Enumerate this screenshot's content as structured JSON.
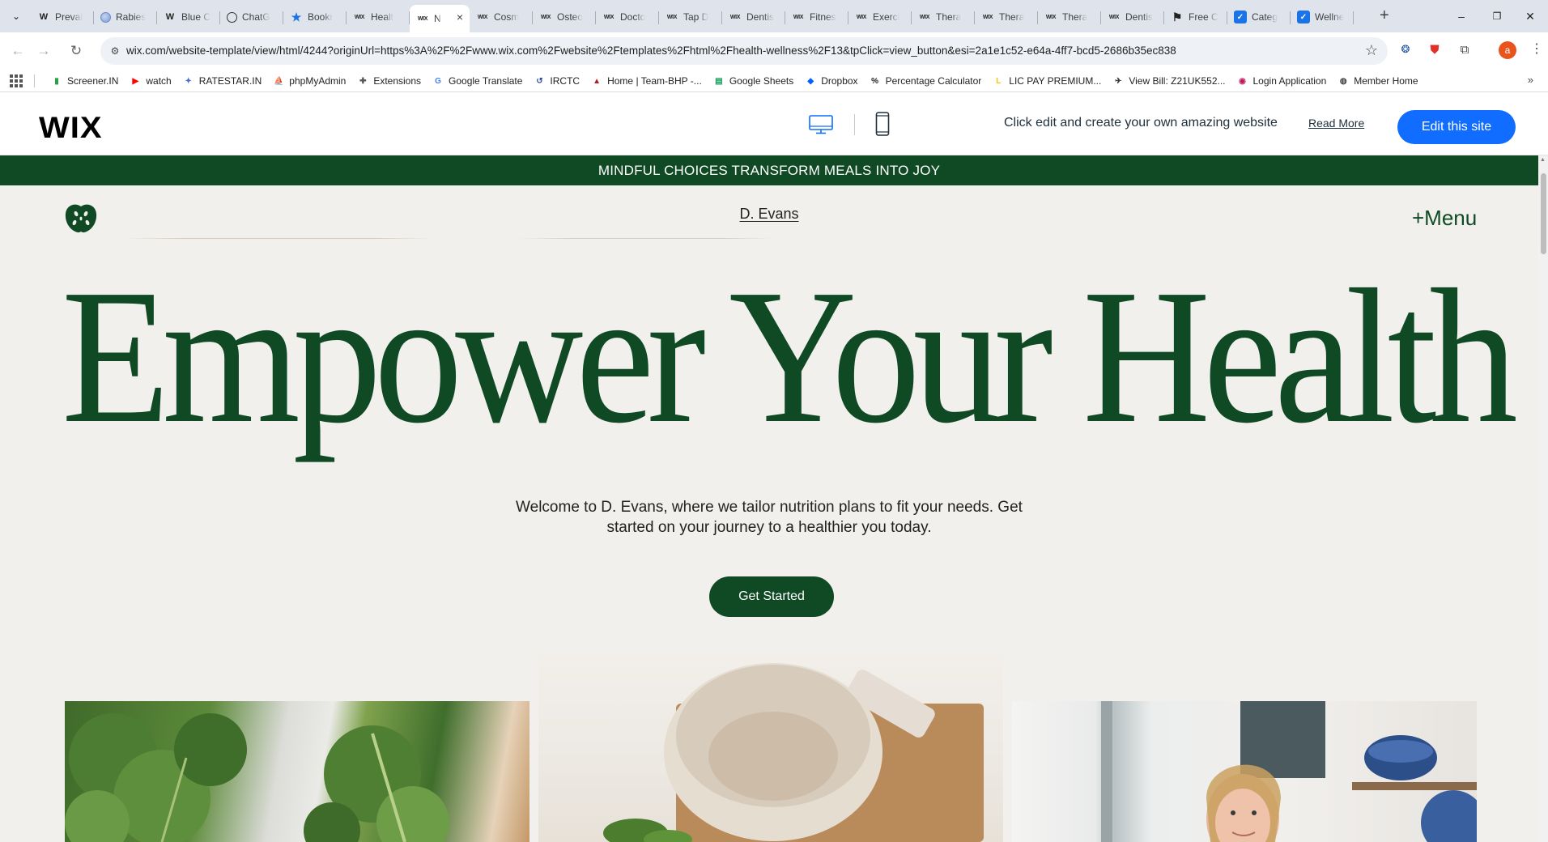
{
  "browser": {
    "tabs": [
      {
        "icon": "W",
        "title": "Preval",
        "style": "w"
      },
      {
        "icon": "globe",
        "title": "Rabies",
        "style": "globe"
      },
      {
        "icon": "W",
        "title": "Blue C",
        "style": "w"
      },
      {
        "icon": "chatgpt",
        "title": "ChatG",
        "style": "gpt"
      },
      {
        "icon": "bookmark-star",
        "title": "Bookr",
        "style": "book"
      },
      {
        "icon": "wix",
        "title": "Healt",
        "style": "wix"
      },
      {
        "icon": "wix",
        "title": "N",
        "style": "wix",
        "active": true
      },
      {
        "icon": "wix",
        "title": "Cosm",
        "style": "wix"
      },
      {
        "icon": "wix",
        "title": "Osteo",
        "style": "wix"
      },
      {
        "icon": "wix",
        "title": "Docto",
        "style": "wix"
      },
      {
        "icon": "wix",
        "title": "Tap D",
        "style": "wix"
      },
      {
        "icon": "wix",
        "title": "Dentis",
        "style": "wix"
      },
      {
        "icon": "wix",
        "title": "Fitnes",
        "style": "wix"
      },
      {
        "icon": "wix",
        "title": "Exerci",
        "style": "wix"
      },
      {
        "icon": "wix",
        "title": "Thera",
        "style": "wix"
      },
      {
        "icon": "wix",
        "title": "Thera",
        "style": "wix"
      },
      {
        "icon": "wix",
        "title": "Thera",
        "style": "wix"
      },
      {
        "icon": "wix",
        "title": "Dentis",
        "style": "wix"
      },
      {
        "icon": "free",
        "title": "Free C",
        "style": "free"
      },
      {
        "icon": "checkbox",
        "title": "Categ",
        "style": "blue"
      },
      {
        "icon": "checkbox",
        "title": "Wellne",
        "style": "blue"
      }
    ],
    "active_tab_close": "×",
    "new_tab": "+",
    "window_controls": {
      "minimize": "–",
      "restore": "❐",
      "close": "✕"
    },
    "url": "wix.com/website-template/view/html/4244?originUrl=https%3A%2F%2Fwww.wix.com%2Fwebsite%2Ftemplates%2Fhtml%2Fhealth-wellness%2F13&tpClick=view_button&esi=2a1e1c52-e64a-4ff7-bcd5-2686b35ec838",
    "profile_initial": "a",
    "bookmarks": [
      {
        "label": "Screener.IN",
        "icon": "bar-chart",
        "color": "#2e9e44"
      },
      {
        "label": "watch",
        "icon": "youtube",
        "color": "#ff0000"
      },
      {
        "label": "RATESTAR.IN",
        "icon": "ratestar",
        "color": "#4a6fd1"
      },
      {
        "label": "phpMyAdmin",
        "icon": "phpmyadmin",
        "color": "#e8a21c"
      },
      {
        "label": "Extensions",
        "icon": "puzzle",
        "color": "#555555"
      },
      {
        "label": "Google Translate",
        "icon": "translate",
        "color": "#4285f4"
      },
      {
        "label": "IRCTC",
        "icon": "irctc",
        "color": "#2b4aa0"
      },
      {
        "label": "Home | Team-BHP -...",
        "icon": "teambhp",
        "color": "#b21e1e"
      },
      {
        "label": "Google Sheets",
        "icon": "sheets",
        "color": "#0f9d58"
      },
      {
        "label": "Dropbox",
        "icon": "dropbox",
        "color": "#0061fe"
      },
      {
        "label": "Percentage Calculator",
        "icon": "percent",
        "color": "#222222"
      },
      {
        "label": "LIC PAY PREMIUM...",
        "icon": "lic",
        "color": "#f2c400"
      },
      {
        "label": "View Bill: Z21UK552...",
        "icon": "bill",
        "color": "#333333"
      },
      {
        "label": "Login Application",
        "icon": "login",
        "color": "#c2185b"
      },
      {
        "label": "Member Home",
        "icon": "globe",
        "color": "#444444"
      }
    ],
    "bookmarks_more": "»"
  },
  "wix_bar": {
    "logo": "WIX",
    "tagline": "Click edit and create your own amazing website",
    "read_more": "Read More",
    "edit_button": "Edit this site"
  },
  "site": {
    "banner": "MINDFUL CHOICES TRANSFORM MEALS INTO JOY",
    "brand": "D. Evans",
    "menu": "+Menu",
    "hero_title": "Empower Your Health",
    "intro": "Welcome to D. Evans, where we tailor nutrition plans to fit your needs. Get started on your journey to a healthier you today.",
    "cta": "Get Started",
    "colors": {
      "primary": "#0f4a24",
      "background": "#f1f0ed",
      "wix_blue": "#116dff"
    }
  }
}
